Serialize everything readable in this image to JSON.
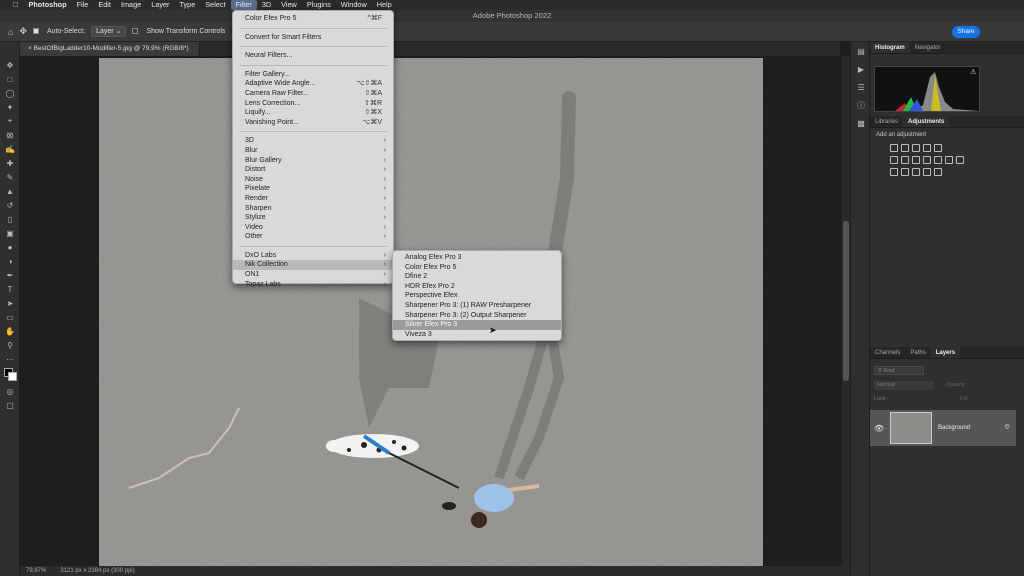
{
  "menubar": {
    "apple_icon": "apple-icon",
    "items": [
      "Photoshop",
      "File",
      "Edit",
      "Image",
      "Layer",
      "Type",
      "Select",
      "Filter",
      "3D",
      "View",
      "Plugins",
      "Window",
      "Help"
    ]
  },
  "window_title": "Adobe Photoshop 2022",
  "options": {
    "auto_select_label": "Auto-Select:",
    "auto_select_value": "Layer",
    "transform_label": "Show Transform Controls",
    "share_label": "Share"
  },
  "document_tab": "BestOfBigLadder10-Modifier-5.jpg @ 79,9% (RGB/8*)",
  "status": {
    "zoom": "79,87%",
    "dimensions": "3121 px x 2384 px (300 ppi)"
  },
  "panels": {
    "top_tabs": [
      "Histogram",
      "Navigator"
    ],
    "mid_tabs": [
      "Libraries",
      "Adjustments"
    ],
    "add_adjustment": "Add an adjustment",
    "layer_tabs": [
      "Channels",
      "Paths",
      "Layers"
    ],
    "kind_placeholder": "Kind",
    "blend_mode": "Normal",
    "opacity_label": "Opacity:",
    "lock_label": "Lock:",
    "fill_label": "Fill:",
    "layer_name": "Background"
  },
  "filter_menu": {
    "top": [
      {
        "label": "Color Efex Pro 5",
        "shortcut": "^⌘F"
      }
    ],
    "smart": [
      {
        "label": "Convert for Smart Filters"
      }
    ],
    "neural": [
      {
        "label": "Neural Filters..."
      }
    ],
    "gallery": [
      {
        "label": "Filter Gallery...",
        "shortcut": ""
      },
      {
        "label": "Adaptive Wide Angle...",
        "shortcut": "⌥⇧⌘A"
      },
      {
        "label": "Camera Raw Filter...",
        "shortcut": "⇧⌘A"
      },
      {
        "label": "Lens Correction...",
        "shortcut": "⇧⌘R"
      },
      {
        "label": "Liquify...",
        "shortcut": "⇧⌘X"
      },
      {
        "label": "Vanishing Point...",
        "shortcut": "⌥⌘V"
      }
    ],
    "groups": [
      "3D",
      "Blur",
      "Blur Gallery",
      "Distort",
      "Noise",
      "Pixelate",
      "Render",
      "Sharpen",
      "Stylize",
      "Video",
      "Other"
    ],
    "plugins": [
      "DxO Labs",
      "Nik Collection",
      "ON1",
      "Topaz Labs"
    ]
  },
  "nik_submenu": [
    "Analog Efex Pro 3",
    "Color Efex Pro 5",
    "Dfine 2",
    "HDR Efex Pro 2",
    "Perspective Efex",
    "Sharpener Pro 3: (1) RAW Presharpener",
    "Sharpener Pro 3: (2) Output Sharpener",
    "Silver Efex Pro 3",
    "Viveza 3"
  ]
}
